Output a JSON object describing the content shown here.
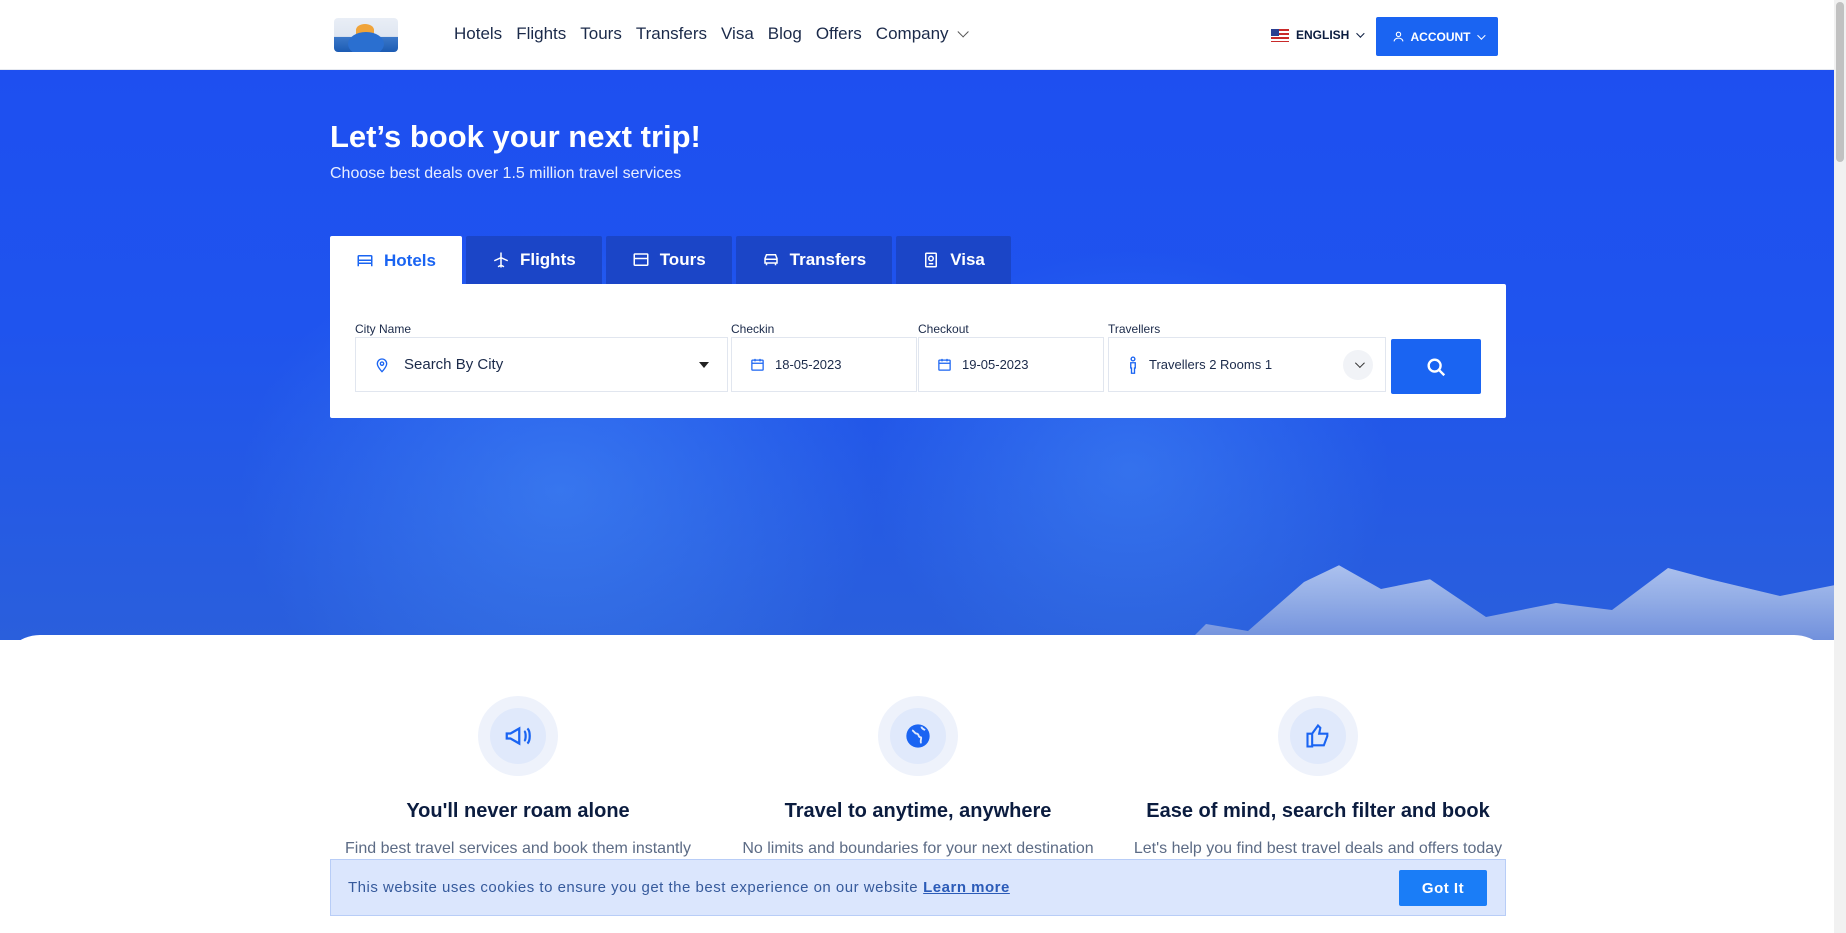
{
  "header": {
    "nav": [
      {
        "label": "Hotels"
      },
      {
        "label": "Flights"
      },
      {
        "label": "Tours"
      },
      {
        "label": "Transfers"
      },
      {
        "label": "Visa"
      },
      {
        "label": "Blog"
      },
      {
        "label": "Offers"
      },
      {
        "label": "Company"
      }
    ],
    "language": "ENGLISH",
    "account": "ACCOUNT"
  },
  "hero": {
    "title": "Let’s book your next trip!",
    "subtitle": "Choose best deals over 1.5 million travel services",
    "tabs": [
      {
        "label": "Hotels",
        "icon": "bed-icon",
        "active": true
      },
      {
        "label": "Flights",
        "icon": "plane-icon"
      },
      {
        "label": "Tours",
        "icon": "briefcase-icon"
      },
      {
        "label": "Transfers",
        "icon": "car-icon"
      },
      {
        "label": "Visa",
        "icon": "passport-icon"
      }
    ]
  },
  "search": {
    "city_label": "City Name",
    "city_placeholder": "Search By City",
    "checkin_label": "Checkin",
    "checkin_value": "18-05-2023",
    "checkout_label": "Checkout",
    "checkout_value": "19-05-2023",
    "travellers_label": "Travellers",
    "travellers_value": "Travellers 2 Rooms 1"
  },
  "features": [
    {
      "title": "You'll never roam alone",
      "desc": "Find best travel services and book them instantly",
      "icon": "megaphone-icon"
    },
    {
      "title": "Travel to anytime, anywhere",
      "desc": "No limits and boundaries for your next destination",
      "icon": "globe-icon"
    },
    {
      "title": "Ease of mind, search filter and book",
      "desc": "Let's help you find best travel deals and offers today",
      "icon": "thumbs-up-icon"
    }
  ],
  "cookie": {
    "text": "This website uses cookies to ensure you get the best experience on our website",
    "link": "Learn more",
    "button": "Got It"
  },
  "colors": {
    "primary": "#1a64f2",
    "hero": "#1e4ff0",
    "tab_inactive": "#1b45c7"
  }
}
